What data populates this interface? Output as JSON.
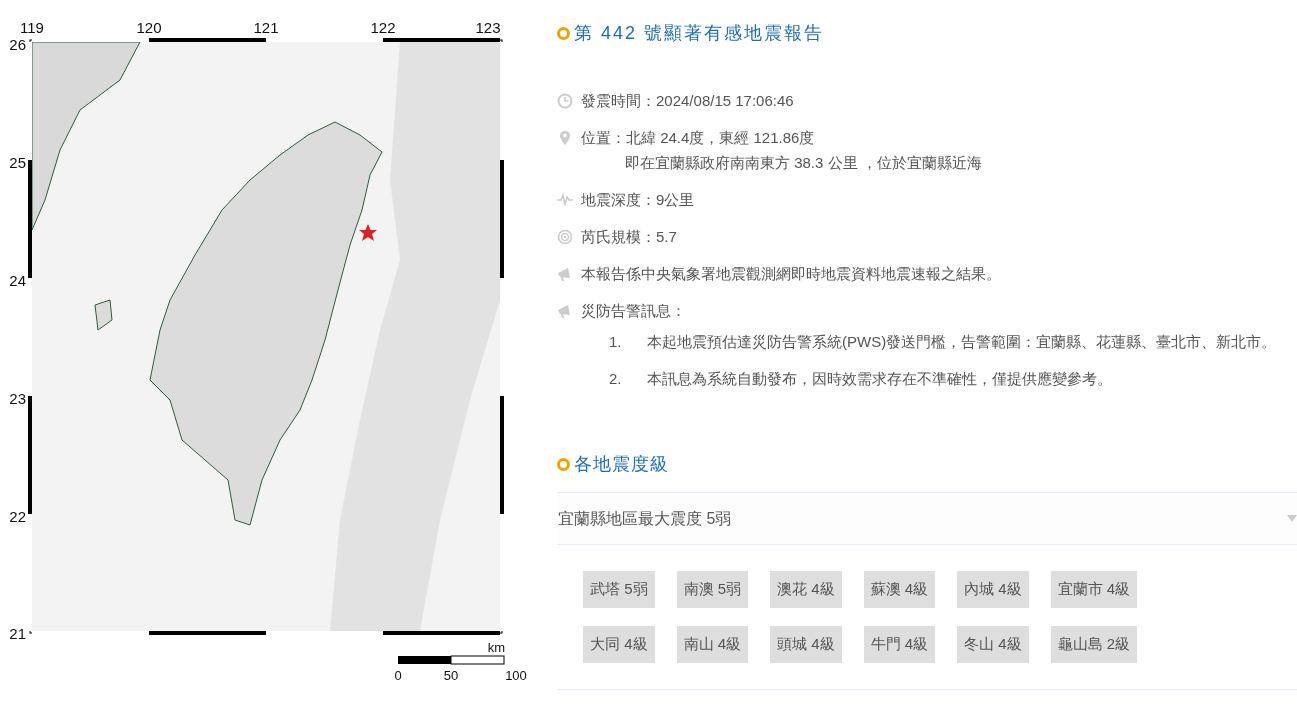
{
  "map": {
    "x_labels": [
      "119",
      "120",
      "121",
      "122",
      "123"
    ],
    "y_labels": [
      "26",
      "25",
      "24",
      "23",
      "22",
      "21"
    ],
    "scale": {
      "unit": "km",
      "labels": [
        "0",
        "50",
        "100"
      ]
    }
  },
  "report": {
    "title": "第 442 號顯著有感地震報告",
    "info": [
      {
        "kind": "time",
        "text": "發震時間：2024/08/15 17:06:46"
      },
      {
        "kind": "location",
        "text": "位置：北緯 24.4度，東經 121.86度",
        "detail": "即在宜蘭縣政府南南東方 38.3 公里 ，位於宜蘭縣近海"
      },
      {
        "kind": "depth",
        "text": "地震深度：9公里"
      },
      {
        "kind": "magnitude",
        "text": "芮氏規模：5.7"
      },
      {
        "kind": "note",
        "text": "本報告係中央氣象署地震觀測網即時地震資料地震速報之結果。"
      },
      {
        "kind": "warning",
        "text": "災防告警訊息：",
        "items": [
          {
            "number": "1.",
            "text": "本起地震預估達災防告警系統(PWS)發送門檻，告警範圍：宜蘭縣、花蓮縣、臺北市、新北市。"
          },
          {
            "number": "2.",
            "text": "本訊息為系統自動發布，因時效需求存在不準確性，僅提供應變參考。"
          }
        ]
      }
    ]
  },
  "intensity": {
    "title": "各地震度級",
    "region": "宜蘭縣地區最大震度 5弱",
    "stations": [
      "武塔 5弱",
      "南澳 5弱",
      "澳花 4級",
      "蘇澳 4級",
      "內城 4級",
      "宜蘭市 4級",
      "大同 4級",
      "南山 4級",
      "頭城 4級",
      "牛門 4級",
      "冬山 4級",
      "龜山島 2級"
    ]
  }
}
